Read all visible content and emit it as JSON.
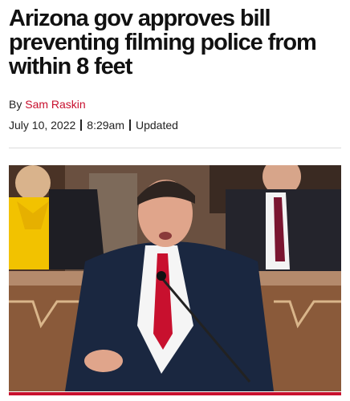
{
  "article": {
    "headline": "Arizona gov approves bill preventing filming police from within 8 feet",
    "byline_prefix": "By",
    "author": "Sam Raskin",
    "date": "July 10, 2022",
    "time": "8:29am",
    "status": "Updated"
  },
  "colors": {
    "accent": "#c8102e",
    "text": "#111111",
    "divider": "#dcdcdc"
  },
  "photo": {
    "icon": "photo"
  }
}
